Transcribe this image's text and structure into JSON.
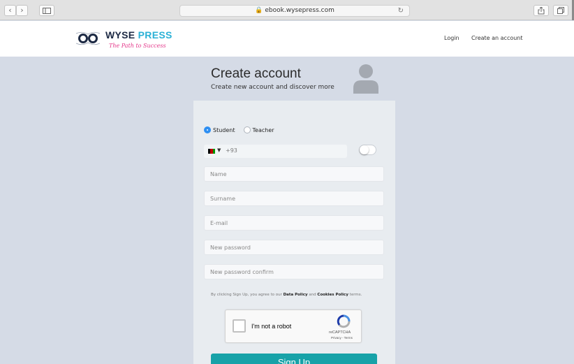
{
  "browser": {
    "url": "ebook.wysepress.com"
  },
  "brand": {
    "name_part1": "WYSE",
    "name_part2": "PRESS",
    "tagline": "The Path to Success",
    "colors": {
      "navy": "#1d2a44",
      "cyan": "#2bb1d6",
      "pink": "#e4388a"
    }
  },
  "nav": {
    "login": "Login",
    "create_account": "Create an account"
  },
  "form": {
    "title": "Create account",
    "subtitle": "Create new account and discover more",
    "roles": [
      {
        "label": "Student",
        "selected": true
      },
      {
        "label": "Teacher",
        "selected": false
      }
    ],
    "phone": {
      "dial_code": "+93",
      "country_flag": "afghanistan-flag"
    },
    "fields": {
      "name": "Name",
      "surname": "Surname",
      "email": "E-mail",
      "password": "New password",
      "password_confirm": "New password confirm"
    },
    "terms": {
      "prefix": "By clicking Sign Up, you agree to our",
      "data_policy": "Data Policy",
      "and": "and",
      "cookies_policy": "Cookies Policy",
      "suffix": "terms."
    },
    "captcha": {
      "label": "I'm not a robot",
      "brand": "reCAPTCHA",
      "links": "Privacy - Terms"
    },
    "submit": "Sign Up",
    "accent_color": "#17a2a8"
  }
}
